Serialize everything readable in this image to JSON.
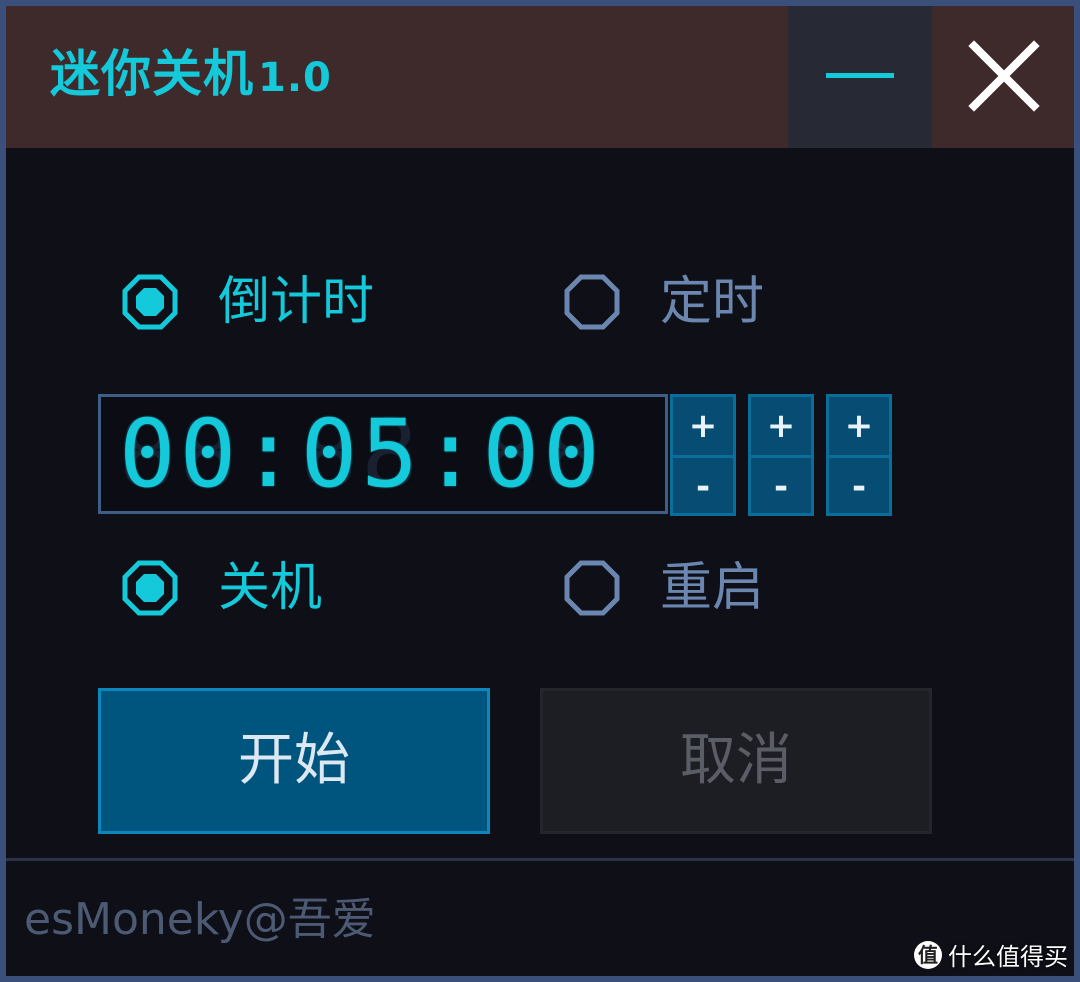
{
  "window": {
    "title": "迷你关机",
    "version": "1.0",
    "minimize_icon": "minimize-icon",
    "close_icon": "close-icon"
  },
  "mode": {
    "options": [
      {
        "label": "倒计时",
        "selected": true
      },
      {
        "label": "定时",
        "selected": false
      }
    ]
  },
  "time": {
    "value": "00:05:00",
    "spinners": [
      {
        "up": "+",
        "down": "-"
      },
      {
        "up": "+",
        "down": "-"
      },
      {
        "up": "+",
        "down": "-"
      }
    ]
  },
  "action": {
    "options": [
      {
        "label": "关机",
        "selected": true
      },
      {
        "label": "重启",
        "selected": false
      }
    ]
  },
  "buttons": {
    "start": "开始",
    "cancel": "取消"
  },
  "footer": {
    "text": "esMoneky@吾爱"
  },
  "watermark": {
    "badge": "值",
    "text": "什么值得买"
  },
  "colors": {
    "accent": "#13c9da",
    "titlebar": "#3e2a2a",
    "background": "#0e0f17",
    "button_primary": "#00557e",
    "button_disabled": "#1d1e24",
    "inactive": "#6b87b0"
  }
}
